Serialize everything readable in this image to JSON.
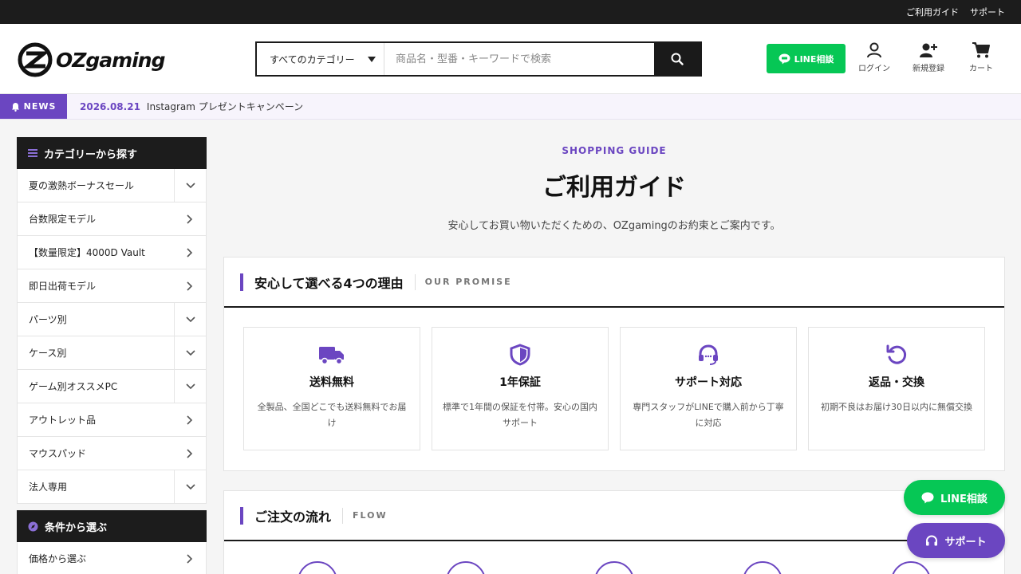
{
  "topbar": {
    "links": [
      "ご利用ガイド",
      "サポート"
    ]
  },
  "header": {
    "logo_text": "OZgaming",
    "search": {
      "category": "すべてのカテゴリー",
      "placeholder": "商品名・型番・キーワードで検索"
    },
    "line_button": "LINE相談",
    "icons": {
      "login": "ログイン",
      "register": "新規登録",
      "cart": "カート"
    }
  },
  "news": {
    "tag": "NEWS",
    "date": "2026.08.21",
    "text": "Instagram プレゼントキャンペーン"
  },
  "sidebar": {
    "heading": "カテゴリーから探す",
    "items": [
      {
        "label": "夏の激熱ボーナスセール"
      },
      {
        "label": "台数限定モデル"
      },
      {
        "label": "【数量限定】4000D Vault"
      },
      {
        "label": "即日出荷モデル"
      },
      {
        "label": "パーツ別"
      },
      {
        "label": "ケース別"
      },
      {
        "label": "ゲーム別オススメPC"
      },
      {
        "label": "アウトレット品"
      },
      {
        "label": "マウスパッド"
      },
      {
        "label": "法人専用"
      }
    ],
    "heading2": "条件から選ぶ",
    "items2": [
      {
        "label": "価格から選ぶ"
      }
    ]
  },
  "guide": {
    "sub": "SHOPPING GUIDE",
    "title": "ご利用ガイド",
    "desc": "安心してお買い物いただくための、OZgamingのお約束とご案内です。"
  },
  "promise": {
    "title": "安心して選べる4つの理由",
    "en": "OUR PROMISE",
    "items": [
      {
        "icon": "truck-icon",
        "title": "送料無料",
        "desc": "全製品、全国どこでも送料無料でお届け"
      },
      {
        "icon": "shield-icon",
        "title": "1年保証",
        "desc": "標準で1年間の保証を付帯。安心の国内サポート"
      },
      {
        "icon": "headset-icon",
        "title": "サポート対応",
        "desc": "専門スタッフがLINEで購入前から丁寧に対応"
      },
      {
        "icon": "return-icon",
        "title": "返品・交換",
        "desc": "初期不良はお届け30日以内に無償交換"
      }
    ]
  },
  "flow": {
    "title": "ご注文の流れ",
    "en": "FLOW"
  },
  "floating": {
    "line": "LINE相談",
    "support": "サポート"
  },
  "colors": {
    "accent": "#6b46c1",
    "line_green": "#06c755",
    "dark": "#1c1c1c"
  }
}
